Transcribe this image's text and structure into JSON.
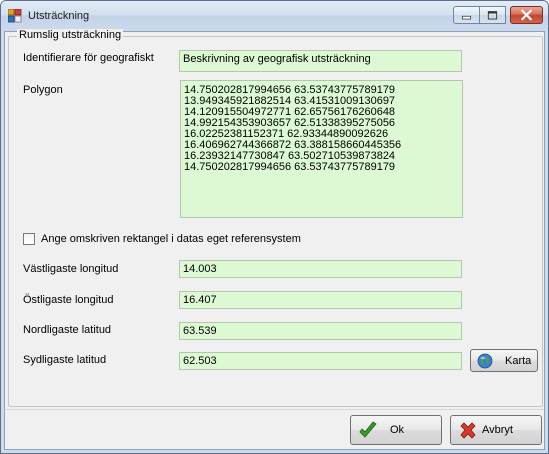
{
  "window": {
    "title": "Utsträckning"
  },
  "group": {
    "label": "Rumslig utsträckning"
  },
  "identifier": {
    "label": "Identifierare för geografiskt",
    "value": "Beskrivning av geografisk utsträckning"
  },
  "polygon": {
    "label": "Polygon",
    "value": "14.750202817994656 63.53743775789179\n13.949345921882514 63.41531009130697\n14.120915504972771 62.65756176260648\n14.992154353903657 62.51338395275056\n16.02252381152371 62.93344890092626\n16.406962744366872 63.388158660445356\n16.23932147730847 63.502710539873824\n14.750202817994656 63.53743775789179"
  },
  "checkbox": {
    "label": "Ange omskriven rektangel i datas eget referensystem",
    "checked": false
  },
  "west": {
    "label": "Västligaste longitud",
    "value": "14.003"
  },
  "east": {
    "label": "Östligaste longitud",
    "value": "16.407"
  },
  "north": {
    "label": "Nordligaste latitud",
    "value": "63.539"
  },
  "south": {
    "label": "Sydligaste latitud",
    "value": "62.503"
  },
  "buttons": {
    "map": "Karta",
    "ok": "Ok",
    "cancel": "Avbryt"
  },
  "colors": {
    "field_bg": "#ddf9d4",
    "frame": "#cfdbea"
  }
}
